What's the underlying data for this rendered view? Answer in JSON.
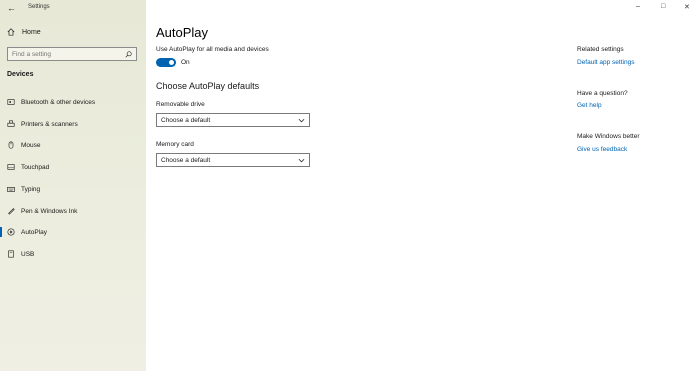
{
  "window": {
    "title": "Settings",
    "back_glyph": "←",
    "minimize_glyph": "–",
    "maximize_glyph": "□",
    "close_glyph": "✕"
  },
  "sidebar": {
    "home_label": "Home",
    "search_placeholder": "Find a setting",
    "section_title": "Devices",
    "items": [
      {
        "label": "Bluetooth & other devices",
        "icon": "bluetooth-icon"
      },
      {
        "label": "Printers & scanners",
        "icon": "printer-icon"
      },
      {
        "label": "Mouse",
        "icon": "mouse-icon"
      },
      {
        "label": "Touchpad",
        "icon": "touchpad-icon"
      },
      {
        "label": "Typing",
        "icon": "keyboard-icon"
      },
      {
        "label": "Pen & Windows Ink",
        "icon": "pen-icon"
      },
      {
        "label": "AutoPlay",
        "icon": "autoplay-icon",
        "active": true
      },
      {
        "label": "USB",
        "icon": "usb-icon"
      }
    ]
  },
  "main": {
    "title": "AutoPlay",
    "toggle_description": "Use AutoPlay for all media and devices",
    "toggle_state": "On",
    "toggle_on": true,
    "defaults_heading": "Choose AutoPlay defaults",
    "removable_drive_label": "Removable drive",
    "removable_drive_value": "Choose a default",
    "memory_card_label": "Memory card",
    "memory_card_value": "Choose a default"
  },
  "related": {
    "heading": "Related settings",
    "default_app_settings": "Default app settings",
    "question_heading": "Have a question?",
    "get_help": "Get help",
    "better_heading": "Make Windows better",
    "feedback": "Give us feedback"
  },
  "colors": {
    "accent": "#0063b1",
    "sidebar_bg": "#ecedde"
  }
}
